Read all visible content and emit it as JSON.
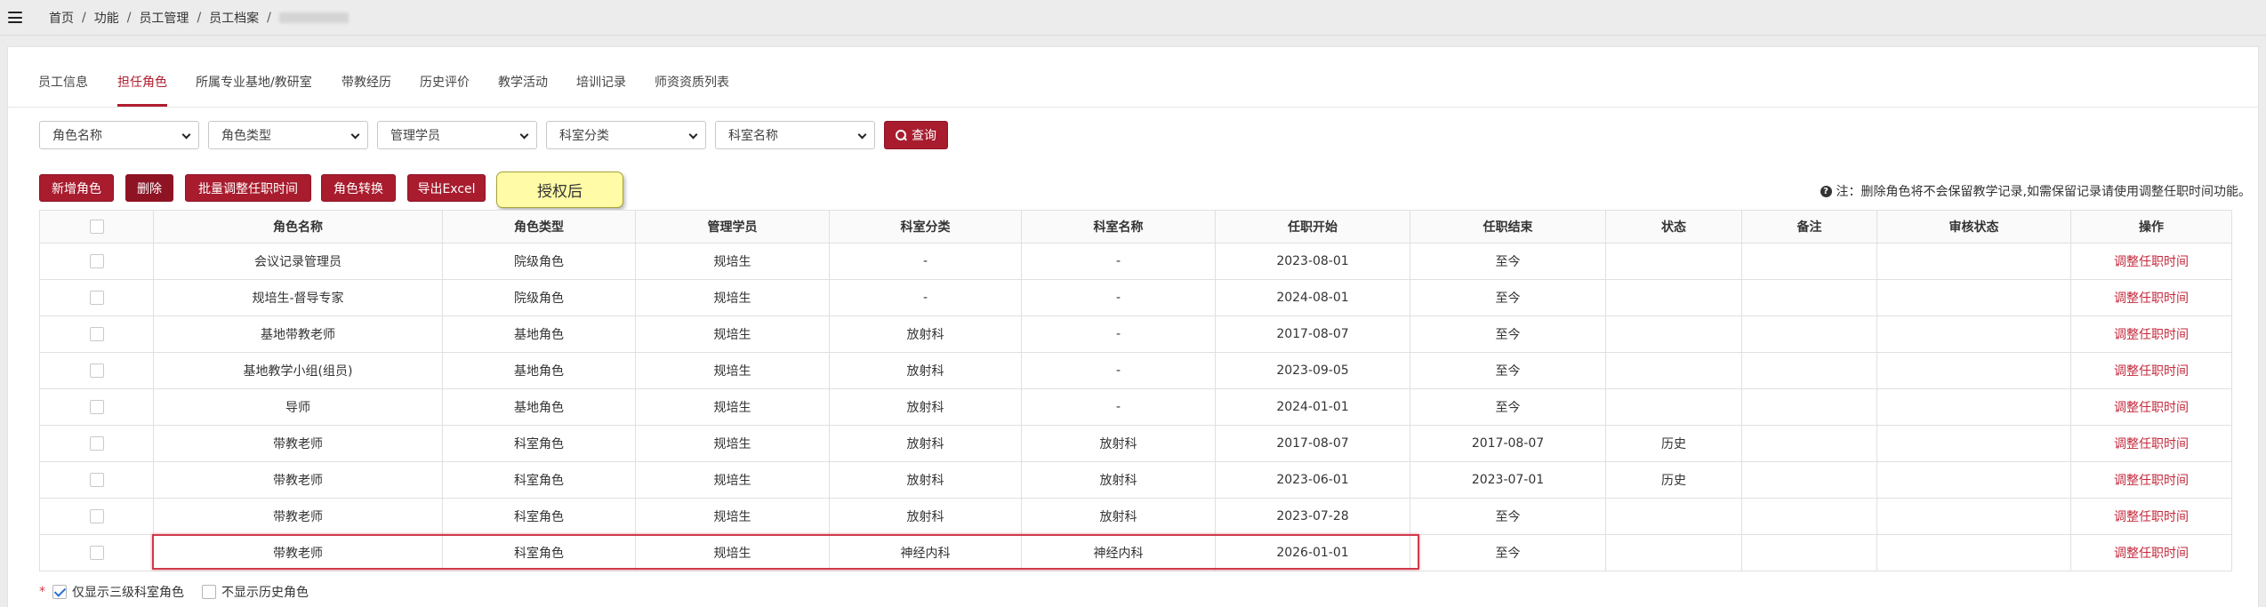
{
  "breadcrumb": [
    "首页",
    "功能",
    "员工管理",
    "员工档案"
  ],
  "tabs": [
    "员工信息",
    "担任角色",
    "所属专业基地/教研室",
    "带教经历",
    "历史评价",
    "教学活动",
    "培训记录",
    "师资资质列表"
  ],
  "active_tab_index": 1,
  "filters": {
    "role_name": "角色名称",
    "role_type": "角色类型",
    "managed_student": "管理学员",
    "dept_category": "科室分类",
    "dept_name": "科室名称",
    "search_label": "查询"
  },
  "actions": {
    "add_role": "新增角色",
    "delete": "删除",
    "batch_adjust": "批量调整任职时间",
    "role_convert": "角色转换",
    "export_excel": "导出Excel",
    "authorized_after": "授权后",
    "note": "注：删除角色将不会保留教学记录,如需保留记录请使用调整任职时间功能。"
  },
  "table": {
    "headers": [
      "",
      "角色名称",
      "角色类型",
      "管理学员",
      "科室分类",
      "科室名称",
      "任职开始",
      "任职结束",
      "状态",
      "备注",
      "审核状态",
      "操作"
    ],
    "rows": [
      [
        "会议记录管理员",
        "院级角色",
        "规培生",
        "-",
        "-",
        "2023-08-01",
        "至今",
        "",
        "",
        "",
        "调整任职时间"
      ],
      [
        "规培生-督导专家",
        "院级角色",
        "规培生",
        "-",
        "-",
        "2024-08-01",
        "至今",
        "",
        "",
        "",
        "调整任职时间"
      ],
      [
        "基地带教老师",
        "基地角色",
        "规培生",
        "放射科",
        "-",
        "2017-08-07",
        "至今",
        "",
        "",
        "",
        "调整任职时间"
      ],
      [
        "基地教学小组(组员)",
        "基地角色",
        "规培生",
        "放射科",
        "-",
        "2023-09-05",
        "至今",
        "",
        "",
        "",
        "调整任职时间"
      ],
      [
        "导师",
        "基地角色",
        "规培生",
        "放射科",
        "-",
        "2024-01-01",
        "至今",
        "",
        "",
        "",
        "调整任职时间"
      ],
      [
        "带教老师",
        "科室角色",
        "规培生",
        "放射科",
        "放射科",
        "2017-08-07",
        "2017-08-07",
        "历史",
        "",
        "",
        "调整任职时间"
      ],
      [
        "带教老师",
        "科室角色",
        "规培生",
        "放射科",
        "放射科",
        "2023-06-01",
        "2023-07-01",
        "历史",
        "",
        "",
        "调整任职时间"
      ],
      [
        "带教老师",
        "科室角色",
        "规培生",
        "放射科",
        "放射科",
        "2023-07-28",
        "至今",
        "",
        "",
        "",
        "调整任职时间"
      ],
      [
        "带教老师",
        "科室角色",
        "规培生",
        "神经内科",
        "神经内科",
        "2026-01-01",
        "至今",
        "",
        "",
        "",
        "调整任职时间"
      ]
    ]
  },
  "footer": {
    "star": "*",
    "show_level3": "仅显示三级科室角色",
    "hide_history": "不显示历史角色"
  },
  "colors": {
    "accent": "#a81c2e",
    "link": "#c4283b",
    "highlight_box": "#d0394a",
    "yellow_button": "#fffba6"
  }
}
